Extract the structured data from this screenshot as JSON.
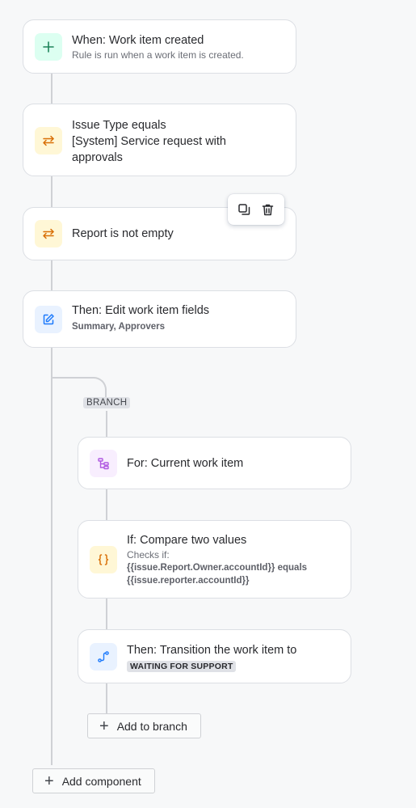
{
  "trigger": {
    "icon": "plus-icon",
    "title": "When: Work item created",
    "description": "Rule is run when a work item is created."
  },
  "condition_issue_type": {
    "icon": "swap-arrows-icon",
    "title": "Issue Type equals",
    "value": "[System] Service request with approvals"
  },
  "condition_report": {
    "icon": "swap-arrows-icon",
    "title": "Report is not empty"
  },
  "toolbar": {
    "duplicate_icon": "duplicate-icon",
    "delete_icon": "trash-icon"
  },
  "action_edit": {
    "icon": "pencil-edit-icon",
    "title": "Then: Edit work item fields",
    "fields": "Summary, Approvers"
  },
  "branch": {
    "tag": "BRANCH",
    "for_title": "For: Current work item",
    "if_title": "If: Compare two values",
    "if_checks_label": "Checks if:",
    "if_expr_line1": "{{issue.Report.Owner.accountId}} equals",
    "if_expr_line2": "{{issue.reporter.accountId}}",
    "transition_title": "Then: Transition the work item to",
    "transition_status": "WAITING FOR SUPPORT",
    "add_label": "Add to branch"
  },
  "add_component_label": "Add component",
  "colors": {
    "trigger_bg": "#dcfff1",
    "trigger_fg": "#1f845a",
    "condition_bg": "#fff7d6",
    "condition_fg": "#d97008",
    "action_bg": "#e9f2ff",
    "action_fg": "#1d7afc",
    "branch_bg": "#f8eefe",
    "branch_fg": "#af59e1"
  }
}
